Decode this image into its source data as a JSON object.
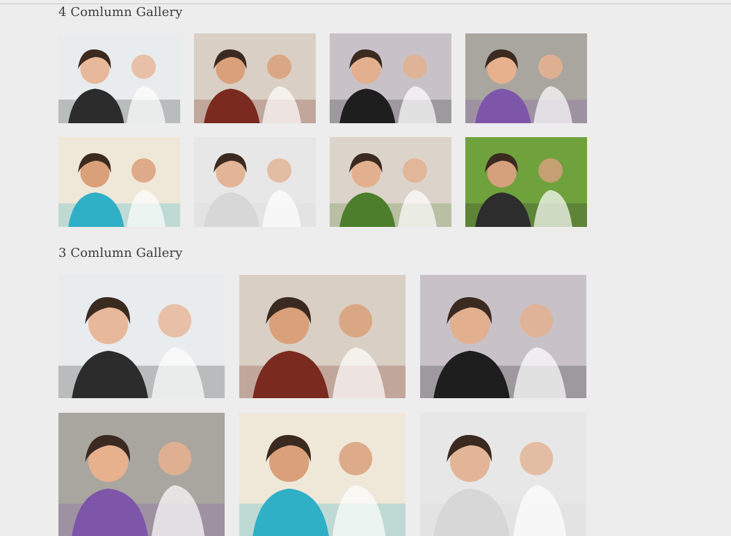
{
  "gallery_4": {
    "title": "4 Comlumn Gallery",
    "items": [
      {
        "name": "photo-woman-smiling-office",
        "bg": "#e9ecee",
        "accent": "#2c2c2c",
        "skin": "#e8b89a"
      },
      {
        "name": "photo-students-library",
        "bg": "#d9cfc4",
        "accent": "#7a2a1e",
        "skin": "#d9a07a"
      },
      {
        "name": "photo-girl-in-class",
        "bg": "#c8c2c8",
        "accent": "#1e1e1e",
        "skin": "#e3b08f"
      },
      {
        "name": "photo-boy-and-girl-reading",
        "bg": "#a9a6a0",
        "accent": "#7e56a9",
        "skin": "#e7b18e"
      },
      {
        "name": "photo-group-of-students",
        "bg": "#efe8d9",
        "accent": "#2fb0c6",
        "skin": "#d9a07a"
      },
      {
        "name": "photo-boy-studying",
        "bg": "#e8e7e7",
        "accent": "#d7d7d7",
        "skin": "#e2b596"
      },
      {
        "name": "photo-students-reading-books",
        "bg": "#dcd4ca",
        "accent": "#4c7e2c",
        "skin": "#e3b08f"
      },
      {
        "name": "photo-students-outdoors",
        "bg": "#6fa23c",
        "accent": "#2d2d2d",
        "skin": "#d5a07c"
      }
    ]
  },
  "gallery_3": {
    "title": "3 Comlumn Gallery",
    "items": [
      {
        "name": "photo-woman-smiling-office",
        "bg": "#e9ecee",
        "accent": "#2c2c2c",
        "skin": "#e8b89a"
      },
      {
        "name": "photo-students-library",
        "bg": "#d9cfc4",
        "accent": "#7a2a1e",
        "skin": "#d9a07a"
      },
      {
        "name": "photo-girl-in-class",
        "bg": "#c8c2c8",
        "accent": "#1e1e1e",
        "skin": "#e3b08f"
      },
      {
        "name": "photo-boy-and-girl-reading",
        "bg": "#a9a6a0",
        "accent": "#7e56a9",
        "skin": "#e7b18e"
      },
      {
        "name": "photo-group-of-students",
        "bg": "#efe8d9",
        "accent": "#2fb0c6",
        "skin": "#d9a07a"
      },
      {
        "name": "photo-boy-studying",
        "bg": "#e8e7e7",
        "accent": "#d7d7d7",
        "skin": "#e2b596"
      }
    ]
  }
}
